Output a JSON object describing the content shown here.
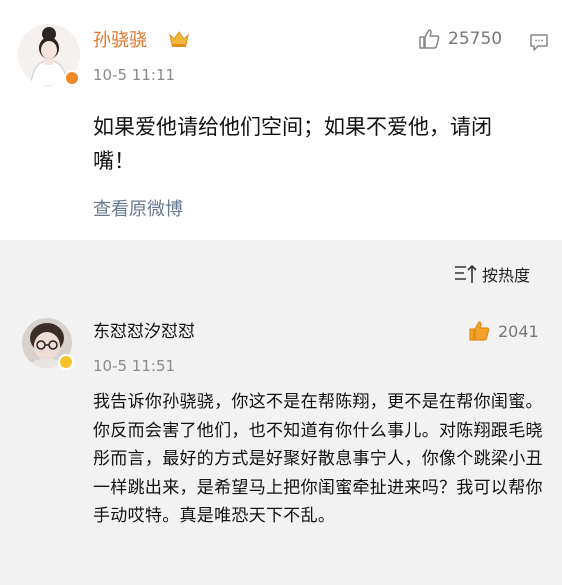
{
  "post": {
    "username": "孙骁骁",
    "time": "10-5 11:11",
    "likes": "25750",
    "text": "如果爱他请给他们空间；如果不爱他，请闭嘴！",
    "view_original": "查看原微博"
  },
  "sort": {
    "label": "按热度"
  },
  "reply": {
    "username": "东怼怼汐怼怼",
    "time": "10-5 11:51",
    "likes": "2041",
    "text": "我告诉你孙骁骁，你这不是在帮陈翔，更不是在帮你闺蜜。你反而会害了他们，也不知道有你什么事儿。对陈翔跟毛晓彤而言，最好的方式是好聚好散息事宁人，你像个跳梁小丑一样跳出来，是希望马上把你闺蜜牵扯进来吗？我可以帮你手动哎特。真是唯恐天下不乱。"
  },
  "colors": {
    "username_main": "#e2762a",
    "link": "#677a92",
    "like_reply_icon": "#f2a12a",
    "badge_orange": "#f18a24",
    "badge_yellow": "#f6c22c"
  },
  "icons": [
    "thumbs-up-icon",
    "comment-icon",
    "sort-icon",
    "vip-crown-icon",
    "verified-badge-icon"
  ]
}
